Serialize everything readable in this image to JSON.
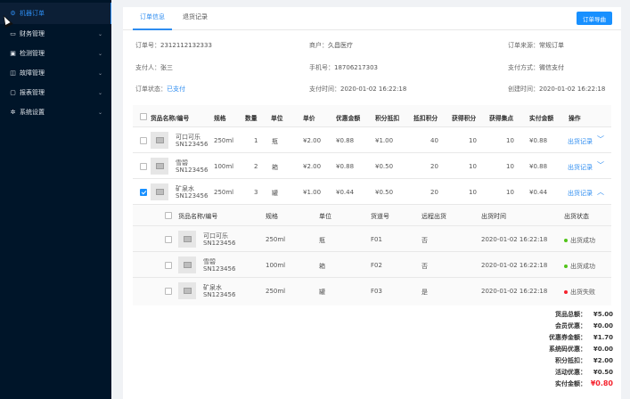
{
  "sidebar": {
    "items": [
      {
        "label": "机器订单",
        "icon": "robot-icon",
        "active": true
      },
      {
        "label": "财务管理",
        "icon": "wallet-icon"
      },
      {
        "label": "检测管理",
        "icon": "check-icon"
      },
      {
        "label": "故障管理",
        "icon": "warning-icon"
      },
      {
        "label": "报表管理",
        "icon": "monitor-icon"
      },
      {
        "label": "系统设置",
        "icon": "gear-icon"
      }
    ]
  },
  "tabs": [
    "订单信息",
    "退货记录"
  ],
  "header_button": "订单导曲",
  "info": {
    "order_no_label": "订单号：",
    "order_no": "2312112132333",
    "merchant_label": "商户：",
    "merchant": "久昌医疗",
    "source_label": "订单来源：",
    "source": "常规订单",
    "payer_label": "支付人：",
    "payer": "张三",
    "phone_label": "手机号：",
    "phone": "18706217303",
    "paymethod_label": "支付方式：",
    "paymethod": "微信支付",
    "status_label": "订单状态：",
    "status": "已支付",
    "paytime_label": "支付时间：",
    "paytime": "2020-01-02 16:22:18",
    "created_label": "创建时间：",
    "created": "2020-01-02 16:22:18"
  },
  "table": {
    "headers": [
      "货品名称/编号",
      "规格",
      "数量",
      "单位",
      "单价",
      "优惠金额",
      "积分抵扣",
      "抵扣积分",
      "获得积分",
      "获得集点",
      "实付金额",
      "操作"
    ],
    "rows": [
      {
        "name": "可口可乐",
        "code": "SN123456",
        "spec": "250ml",
        "qty": "1",
        "unit": "瓶",
        "price": "¥2.00",
        "discount": "¥0.88",
        "points_deduct": "¥1.00",
        "points_used": "40",
        "points_earned": "10",
        "stamps": "10",
        "paid": "¥0.88",
        "action": "出货记录",
        "checked": false,
        "arrow": "﹀"
      },
      {
        "name": "雪碧",
        "code": "SN123456",
        "spec": "100ml",
        "qty": "2",
        "unit": "箱",
        "price": "¥2.00",
        "discount": "¥0.88",
        "points_deduct": "¥0.50",
        "points_used": "20",
        "points_earned": "10",
        "stamps": "10",
        "paid": "¥0.88",
        "action": "出货记录",
        "checked": false,
        "arrow": "﹀"
      },
      {
        "name": "矿泉水",
        "code": "SN123456",
        "spec": "250ml",
        "qty": "3",
        "unit": "罐",
        "price": "¥1.00",
        "discount": "¥0.44",
        "points_deduct": "¥0.50",
        "points_used": "20",
        "points_earned": "10",
        "stamps": "10",
        "paid": "¥0.44",
        "action": "出货记录",
        "checked": true,
        "arrow": "︿"
      }
    ]
  },
  "subtable": {
    "headers": [
      "货品名称/编号",
      "规格",
      "单位",
      "货道号",
      "远程出货",
      "出货时间",
      "出货状态"
    ],
    "rows": [
      {
        "name": "可口可乐",
        "code": "SN123456",
        "spec": "250ml",
        "unit": "瓶",
        "lane": "F01",
        "remote": "否",
        "time": "2020-01-02 16:22:18",
        "status": "出货成功",
        "status_color": "#52c41a"
      },
      {
        "name": "雪碧",
        "code": "SN123456",
        "spec": "100ml",
        "unit": "箱",
        "lane": "F02",
        "remote": "否",
        "time": "2020-01-02 16:22:18",
        "status": "出货成功",
        "status_color": "#52c41a"
      },
      {
        "name": "矿泉水",
        "code": "SN123456",
        "spec": "250ml",
        "unit": "罐",
        "lane": "F03",
        "remote": "是",
        "time": "2020-01-02 16:22:18",
        "status": "出货失败",
        "status_color": "#f5222d"
      }
    ]
  },
  "summary": [
    {
      "label": "货品总额：",
      "value": "¥5.00"
    },
    {
      "label": "会员优惠：",
      "value": "¥0.00"
    },
    {
      "label": "优惠券金额：",
      "value": "¥1.70"
    },
    {
      "label": "系统码优惠：",
      "value": "¥0.00"
    },
    {
      "label": "积分抵扣：",
      "value": "¥2.00"
    },
    {
      "label": "活动优惠：",
      "value": "¥0.50"
    },
    {
      "label": "实付金额：",
      "value": "¥0.80",
      "highlight": "#f5222d"
    }
  ]
}
